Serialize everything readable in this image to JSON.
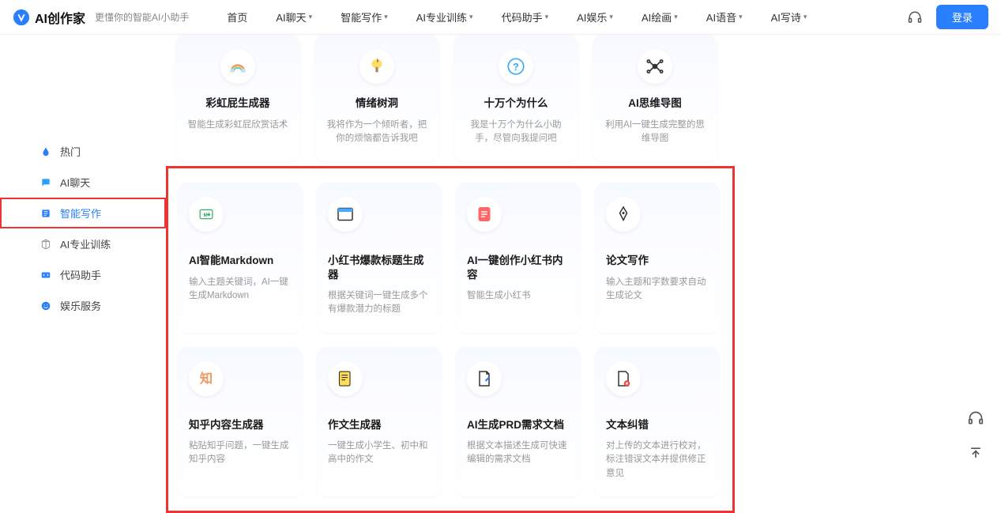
{
  "header": {
    "logo_text": "AI创作家",
    "tagline": "更懂你的智能AI小助手",
    "nav": [
      {
        "label": "首页",
        "dropdown": false
      },
      {
        "label": "AI聊天",
        "dropdown": true
      },
      {
        "label": "智能写作",
        "dropdown": true
      },
      {
        "label": "AI专业训练",
        "dropdown": true
      },
      {
        "label": "代码助手",
        "dropdown": true
      },
      {
        "label": "AI娱乐",
        "dropdown": true
      },
      {
        "label": "AI绘画",
        "dropdown": true
      },
      {
        "label": "AI语音",
        "dropdown": true
      },
      {
        "label": "AI写诗",
        "dropdown": true
      }
    ],
    "login": "登录"
  },
  "sidebar": {
    "items": [
      {
        "icon": "fire",
        "label": "热门"
      },
      {
        "icon": "chat",
        "label": "AI聊天"
      },
      {
        "icon": "edit",
        "label": "智能写作",
        "active": true
      },
      {
        "icon": "cube",
        "label": "AI专业训练"
      },
      {
        "icon": "code",
        "label": "代码助手"
      },
      {
        "icon": "smile",
        "label": "娱乐服务"
      }
    ]
  },
  "top_cards": [
    {
      "icon": "rainbow",
      "title": "彩虹屁生成器",
      "desc": "智能生成彩虹屁欣赏话术"
    },
    {
      "icon": "tree",
      "title": "情绪树洞",
      "desc": "我将作为一个倾听者，把你的烦恼都告诉我吧"
    },
    {
      "icon": "question",
      "title": "十万个为什么",
      "desc": "我是十万个为什么小助手，尽管向我提问吧"
    },
    {
      "icon": "mindmap",
      "title": "AI思维导图",
      "desc": "利用AI一键生成完整的思维导图"
    }
  ],
  "main_cards": [
    {
      "icon": "markdown",
      "title": "AI智能Markdown",
      "desc": "输入主题关键词，AI一键生成Markdown"
    },
    {
      "icon": "window",
      "title": "小红书爆款标题生成器",
      "desc": "根据关键词一键生成多个有爆款潜力的标题"
    },
    {
      "icon": "note",
      "title": "AI一键创作小红书内容",
      "desc": "智能生成小红书"
    },
    {
      "icon": "pen",
      "title": "论文写作",
      "desc": "输入主题和字数要求自动生成论文"
    },
    {
      "icon": "zhi",
      "title": "知乎内容生成器",
      "desc": "粘贴知乎问题，一键生成知乎内容"
    },
    {
      "icon": "essay",
      "title": "作文生成器",
      "desc": "一键生成小学生、初中和高中的作文"
    },
    {
      "icon": "doc",
      "title": "AI生成PRD需求文档",
      "desc": "根据文本描述生成可快速编辑的需求文档"
    },
    {
      "icon": "correct",
      "title": "文本纠错",
      "desc": "对上传的文本进行校对，标注错误文本并提供修正意见"
    }
  ]
}
